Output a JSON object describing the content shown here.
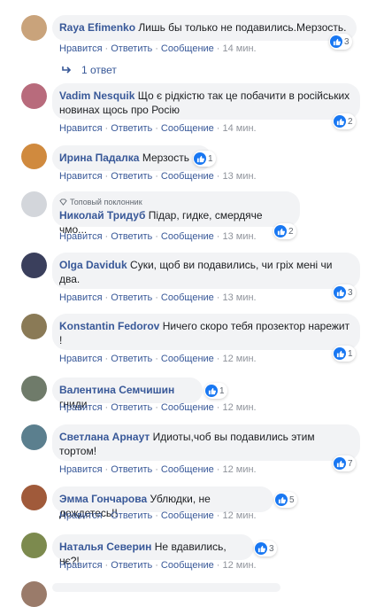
{
  "actions": {
    "like": "Нравится",
    "reply": "Ответить",
    "message": "Сообщение",
    "sep": "·"
  },
  "replies_link": "1 ответ",
  "top_fan_badge": "Топовый поклонник",
  "colors": {
    "link": "#385898",
    "bubble": "#f2f3f5",
    "like": "#1877f2",
    "meta": "#90949c"
  },
  "comments": [
    {
      "name": "Raya Efimenko",
      "text": "Лишь бы только не подавились.Мерзость.",
      "reactions": "3",
      "time": "14 мин."
    },
    {
      "name": "Vadim Nesquik",
      "text": "Що є рідкістю так це побачити в російських новинах щось про Росію",
      "reactions": "2",
      "time": "14 мин."
    },
    {
      "name": "Ирина Падалка",
      "text": "Мерзость",
      "reactions": "1",
      "time": "13 мин."
    },
    {
      "name": "Николай Тридуб",
      "text": "Підар, гидке, смердяче чмо...",
      "reactions": "2",
      "time": "13 мин."
    },
    {
      "name": "Olga Daviduk",
      "text": "Суки, щоб ви подавились, чи гріх мені чи два.",
      "reactions": "3",
      "time": "13 мин."
    },
    {
      "name": "Konstantin Fedorov",
      "text": "Ничего скоро тебя прозектор нарежит !",
      "reactions": "1",
      "time": "12 мин."
    },
    {
      "name": "Валентина Семчишин",
      "text": "гниди",
      "reactions": "1",
      "time": "12 мин."
    },
    {
      "name": "Светлана Арнаут",
      "text": "Идиоты,чоб вы подавились этим тортом!",
      "reactions": "7",
      "time": "12 мин."
    },
    {
      "name": "Эмма Гончарова",
      "text": "Ублюдки, не дождетесь!!",
      "reactions": "5",
      "time": "12 мин."
    },
    {
      "name": "Наталья Северин",
      "text": "Не вдавились, нє?!",
      "reactions": "3",
      "time": "12 мин."
    }
  ]
}
